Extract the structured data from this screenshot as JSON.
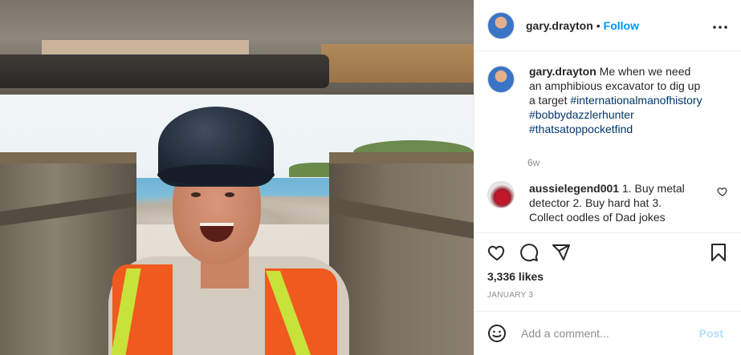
{
  "post": {
    "username": "gary.drayton",
    "follow_label": "Follow",
    "separator": "•",
    "more_label": "•••"
  },
  "caption": {
    "username": "gary.drayton",
    "text": "Me when we need an amphibious excavator to dig up a target",
    "hashtags": [
      "#internationalmanofhistory",
      "#bobbydazzlerhunter",
      "#thatsatoppocketfind"
    ],
    "time_ago": "6w"
  },
  "comments": [
    {
      "username": "aussielegend001",
      "text": "1. Buy metal detector 2. Buy hard hat 3. Collect oodles of Dad jokes"
    }
  ],
  "stats": {
    "likes": "3,336 likes",
    "date": "JANUARY 3"
  },
  "composer": {
    "placeholder": "Add a comment...",
    "post_label": "Post"
  },
  "colors": {
    "accent": "#0095f6",
    "hashtag": "#00376b",
    "muted": "#8e8e8e",
    "post_disabled": "#b2dffc"
  },
  "icons": [
    "heart-icon",
    "comment-icon",
    "share-icon",
    "bookmark-icon",
    "emoji-icon",
    "more-icon"
  ]
}
